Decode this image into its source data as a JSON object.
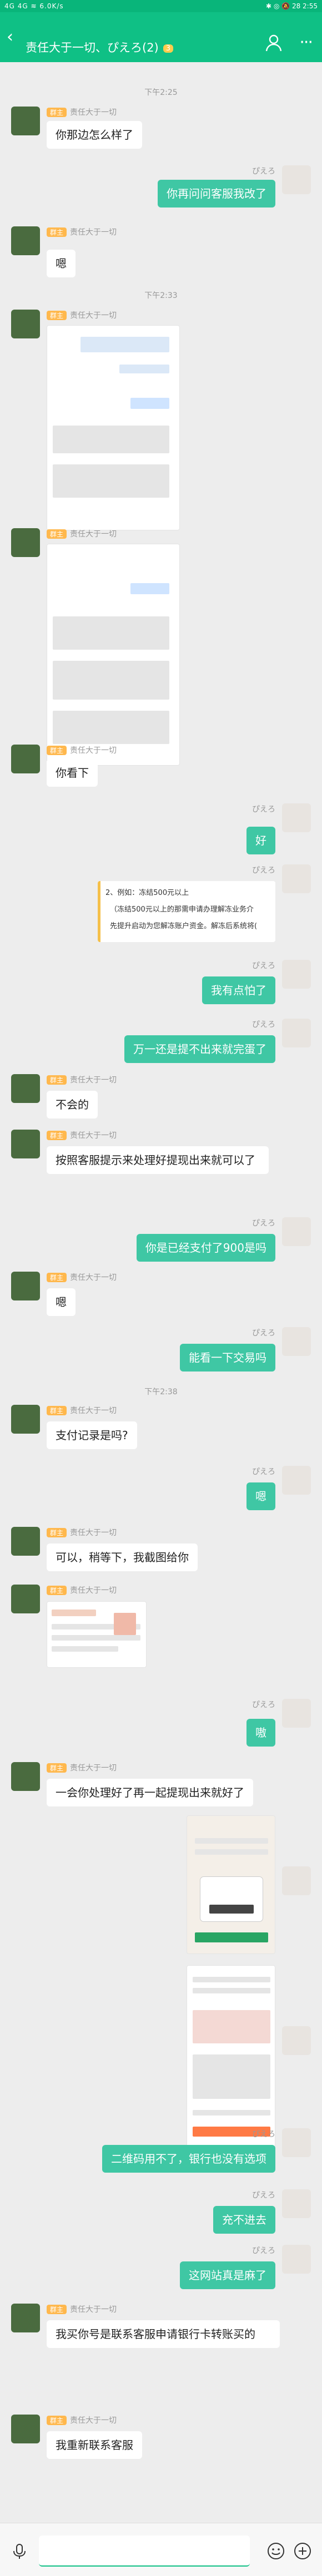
{
  "status_bar": {
    "left": "4G 4G ≋ 6.0K/s",
    "right": "✱ ◎ 🔕 28 2:55"
  },
  "header": {
    "back": "‹",
    "title": "责任大于一切、ぴえろ(2)",
    "badge": "3"
  },
  "chat": {
    "timestamps": [
      "下午2:25",
      "下午2:33",
      "下午2:38"
    ],
    "tag": "群主",
    "left_name": "责任大于一切",
    "right_name": "ぴえろ",
    "messages": [
      {
        "side": "left",
        "text": "你那边怎么样了"
      },
      {
        "side": "right",
        "text": "你再问问客服我改了"
      },
      {
        "side": "left",
        "text": "嗯"
      },
      {
        "side": "left",
        "text": "你看下"
      },
      {
        "side": "right",
        "text": "好"
      },
      {
        "side": "right",
        "text": "我有点怕了"
      },
      {
        "side": "right",
        "text": "万一还是提不出来就完蛋了"
      },
      {
        "side": "left",
        "text": "不会的"
      },
      {
        "side": "left",
        "text": "按照客服提示来处理好提现出来就可以了"
      },
      {
        "side": "right",
        "text": "你是已经支付了900是吗"
      },
      {
        "side": "left",
        "text": "嗯"
      },
      {
        "side": "right",
        "text": "能看一下交易吗"
      },
      {
        "side": "left",
        "text": "支付记录是吗?"
      },
      {
        "side": "right",
        "text": "嗯"
      },
      {
        "side": "left",
        "text": "可以，稍等下，我截图给你"
      },
      {
        "side": "right",
        "text": "嗷"
      },
      {
        "side": "left",
        "text": "一会你处理好了再一起提现出来就好了"
      },
      {
        "side": "right",
        "text": "二维码用不了，银行也没有选项"
      },
      {
        "side": "right",
        "text": "充不进去"
      },
      {
        "side": "right",
        "text": "这网站真是麻了"
      },
      {
        "side": "left",
        "text": "我买你号是联系客服申请银行卡转账买的"
      },
      {
        "side": "left",
        "text": "我重新联系客服"
      }
    ],
    "quote_image": {
      "line1": "2、例如：冻结500元以上",
      "line2": "（冻结500元以上的那需申请办理解冻业务介",
      "line3": "先提升启动为您解冻账户资金。解冻后系统将("
    }
  },
  "input": {
    "placeholder": ""
  },
  "colors": {
    "header": "#0fc085",
    "right_bubble": "#3fc7a4",
    "tag": "#ffb84d",
    "background": "#ededed"
  }
}
